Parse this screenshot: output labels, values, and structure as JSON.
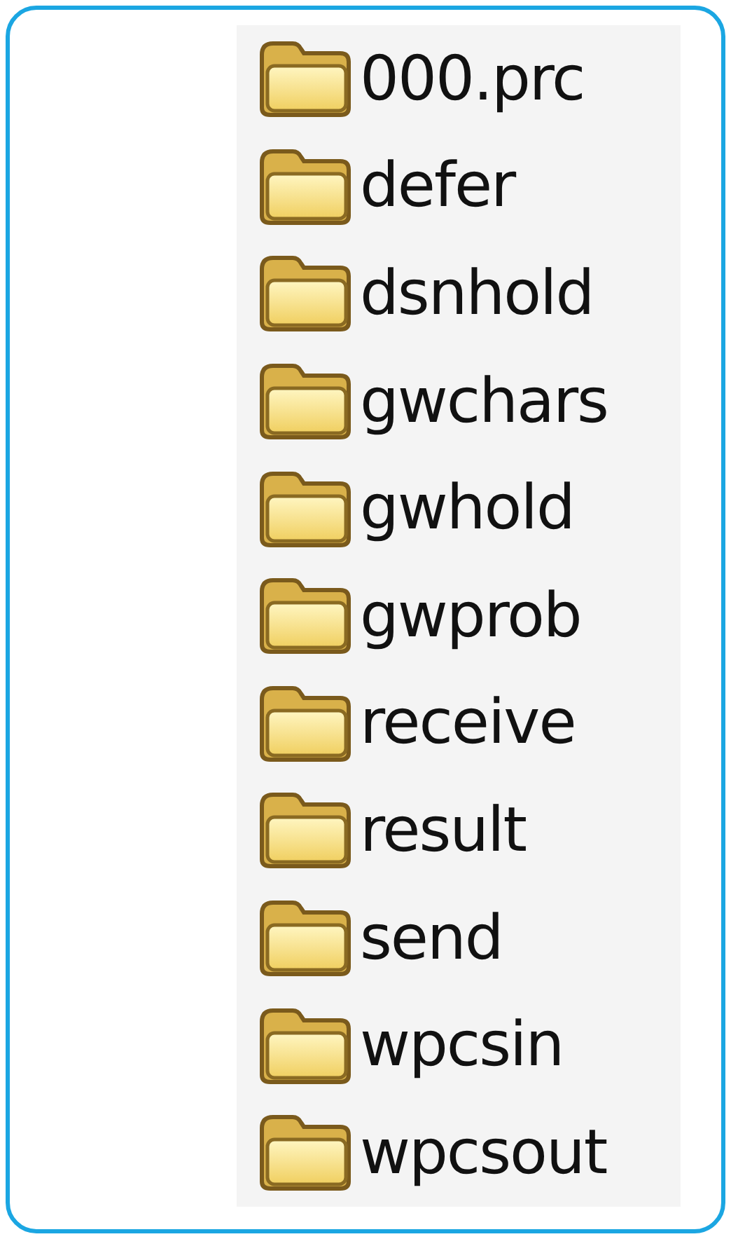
{
  "folders": [
    {
      "name": "000.prc"
    },
    {
      "name": "defer"
    },
    {
      "name": "dsnhold"
    },
    {
      "name": "gwchars"
    },
    {
      "name": "gwhold"
    },
    {
      "name": "gwprob"
    },
    {
      "name": "receive"
    },
    {
      "name": "result"
    },
    {
      "name": "send"
    },
    {
      "name": "wpcsin"
    },
    {
      "name": "wpcsout"
    }
  ]
}
